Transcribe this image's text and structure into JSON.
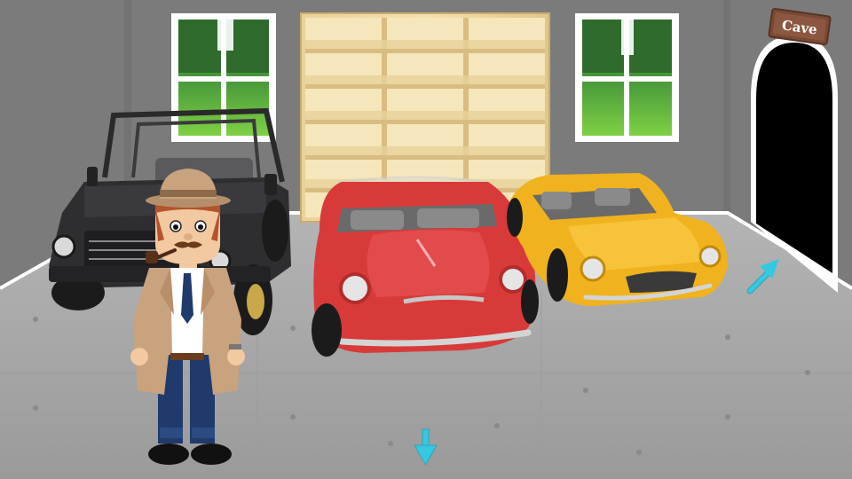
{
  "room": {
    "wall_color": "#7b7b7b",
    "floor_color": "#a9a9a9",
    "trim_color": "#ffffff"
  },
  "exit_sign": {
    "label": "Cave",
    "sign_color": "#7a4a35"
  },
  "navigation": {
    "exit_arrow_icon": "arrow-up-right-icon",
    "back_arrow_icon": "arrow-down-icon",
    "arrow_color": "#36c8e0"
  },
  "vehicles": [
    {
      "name": "black-jeep",
      "color": "#2e2e30"
    },
    {
      "name": "red-convertible",
      "color": "#d83a3a"
    },
    {
      "name": "yellow-roadster",
      "color": "#f0b21e"
    }
  ],
  "character": {
    "name": "detective",
    "coat_color": "#c9a27e",
    "hat_color": "#c9a27e"
  }
}
